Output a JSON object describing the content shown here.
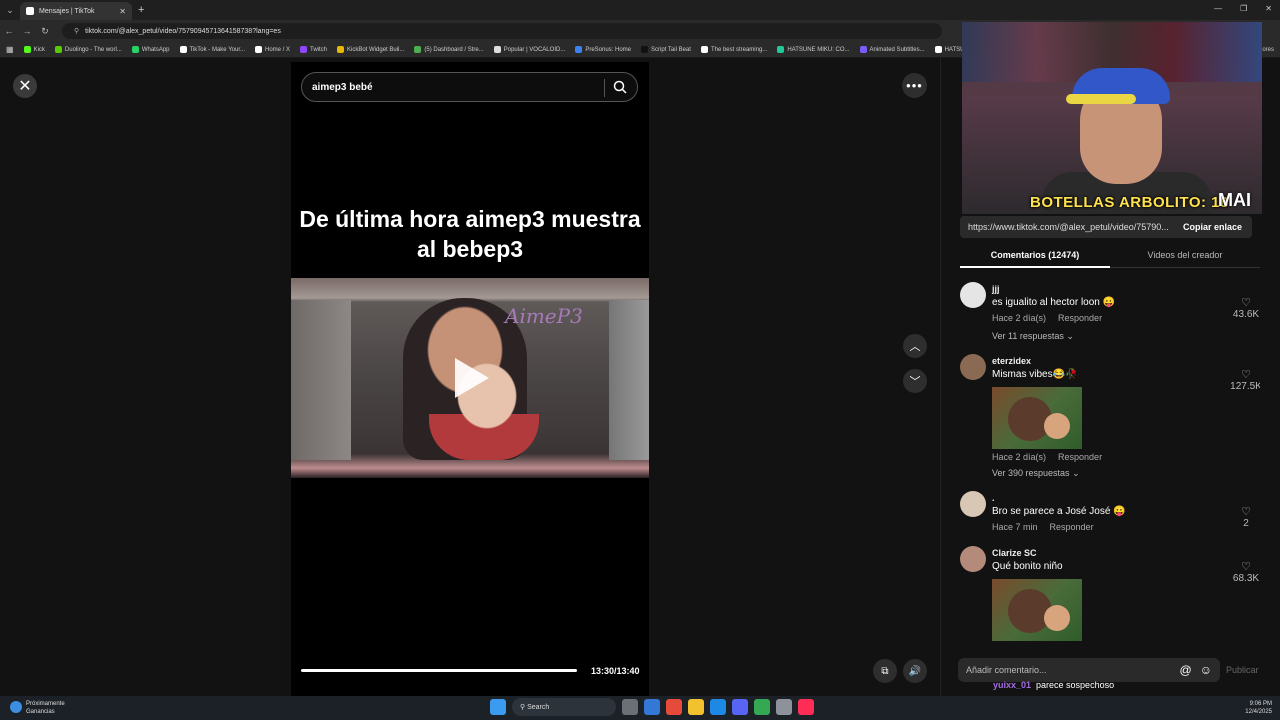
{
  "browser": {
    "tab_title": "Mensajes | TikTok",
    "url": "tiktok.com/@alex_petul/video/7579094571364158738?lang=es",
    "bookmarks": [
      "Kick",
      "Duolingo - The worl...",
      "WhatsApp",
      "TikTok - Make Your...",
      "Home / X",
      "Twitch",
      "KickBot Widget Buil...",
      "(5) Dashboard / Stre...",
      "Popular | VOCALOID...",
      "PreSonus: Home",
      "Script Tail Beat",
      "The best streaming...",
      "HATSUNE MIKU: CO...",
      "Animated Subtitles...",
      "HATSUNE I"
    ],
    "bookmark_colors": [
      "#53fc18",
      "#58cc02",
      "#25d366",
      "#ffffff",
      "#ffffff",
      "#9146ff",
      "#e6b800",
      "#4caf50",
      "#dddddd",
      "#3b82f6",
      "#111111",
      "#ffffff",
      "#20c997",
      "#7c5cff",
      "#ffffff"
    ],
    "bookmarks_more": "ores"
  },
  "video": {
    "search_query": "aimep3 bebé",
    "headline": "De última hora aimep3 muestra al bebep3",
    "thumb_logo": "AimeP3",
    "time": "13:30/13:40",
    "progress": 0.988
  },
  "webcam": {
    "overlay_text": "BOTELLAS ARBOLITO: 18",
    "tag": "MAI"
  },
  "panel": {
    "link": "https://www.tiktok.com/@alex_petul/video/75790...",
    "copy_label": "Copiar enlace",
    "tabs": [
      "Comentarios (12474)",
      "Videos del creador"
    ],
    "comments": [
      {
        "user": "jjj",
        "text": "es igualito al hector loon 😛",
        "time": "Hace 2 día(s)",
        "reply": "Responder",
        "replies": "Ver 11 respuestas",
        "likes": "43.6K"
      },
      {
        "user": "eterzidex",
        "text": "Mismas vibes😂🥀",
        "time": "Hace 2 día(s)",
        "reply": "Responder",
        "replies": "Ver 390 respuestas",
        "likes": "127.5K"
      },
      {
        "user": ".",
        "text": "Bro se parece a José José 😛",
        "time": "Hace 7 min",
        "reply": "Responder",
        "likes": "2"
      },
      {
        "user": "Clarize SC",
        "text": "Qué bonito niño",
        "likes": "68.3K"
      }
    ],
    "comment_placeholder": "Añadir comentario...",
    "publish": "Publicar",
    "chat_user": "yuixx_01",
    "chat_text": "parece sospechoso"
  },
  "taskbar": {
    "weather_title": "Próximamente",
    "weather_sub": "Ganancias",
    "search": "Search",
    "time": "9:06 PM",
    "date": "12/4/2025"
  }
}
